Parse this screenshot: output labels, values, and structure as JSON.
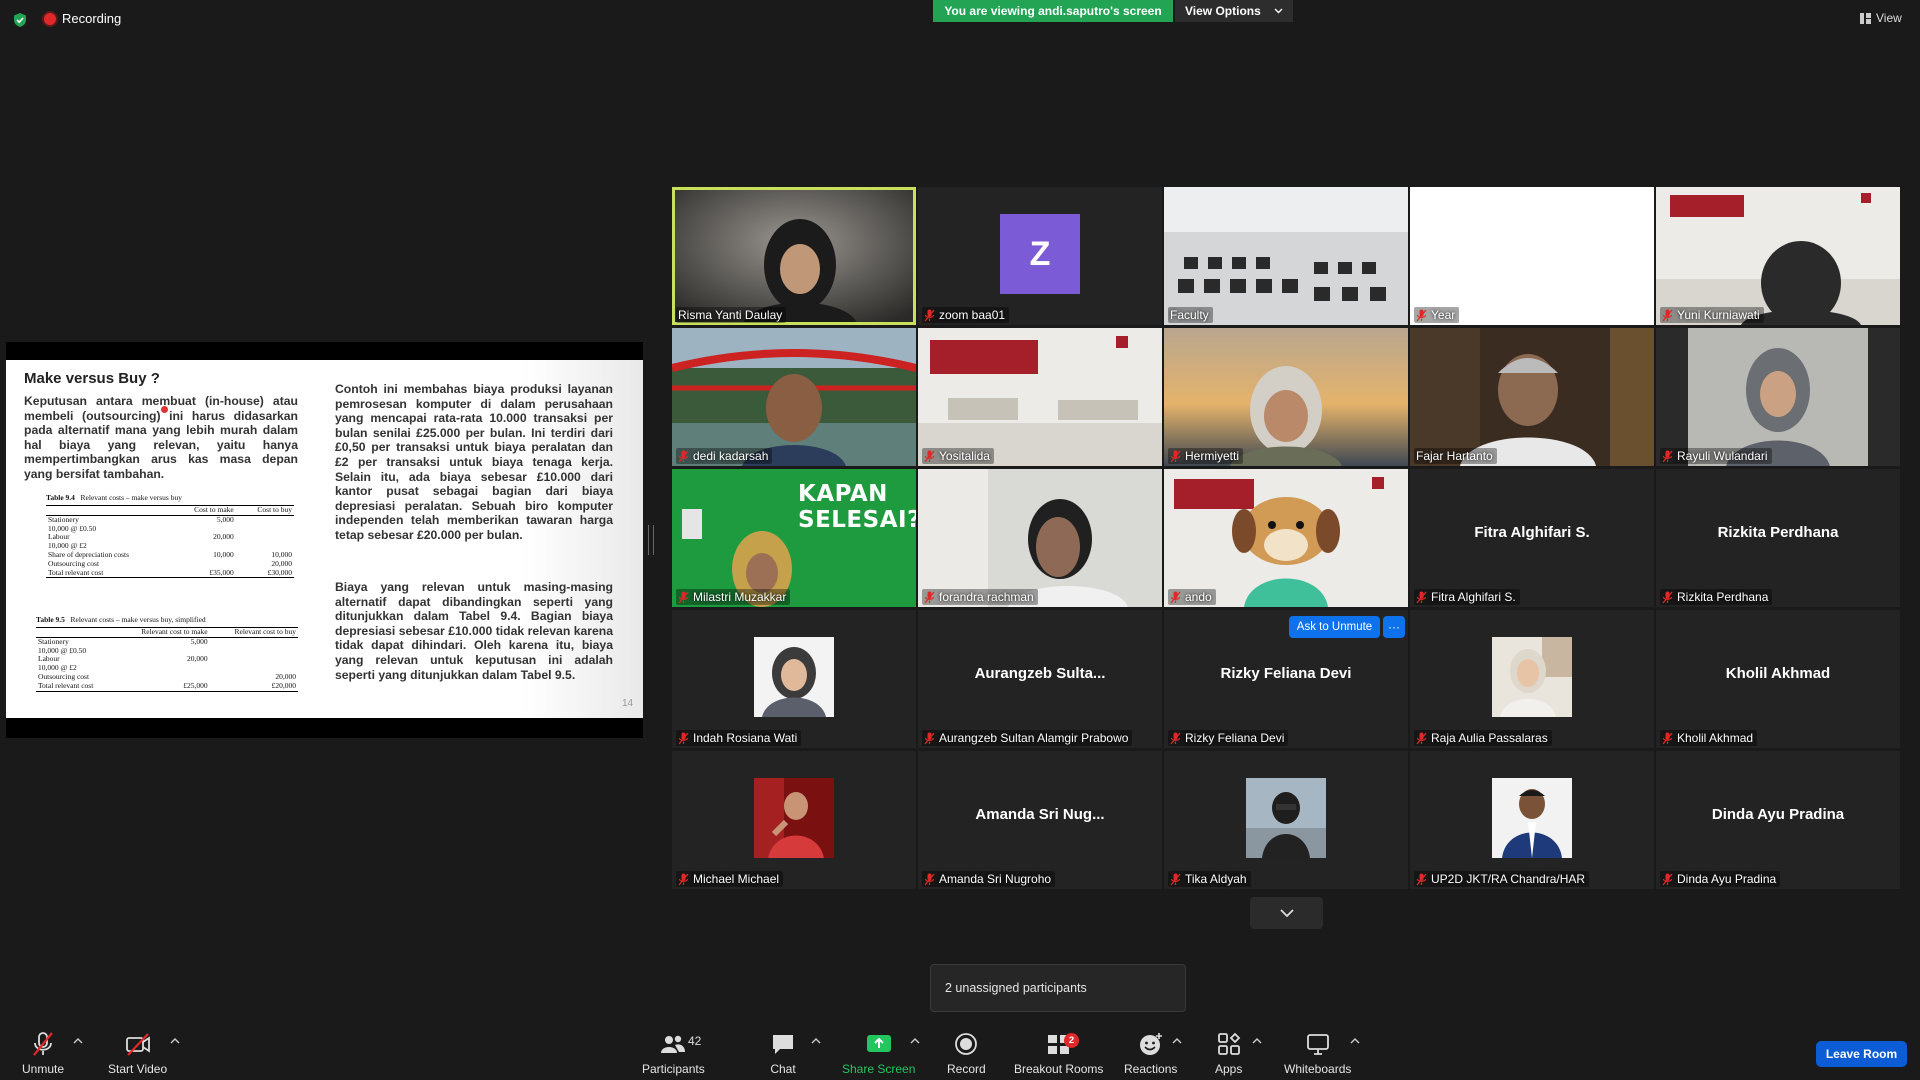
{
  "top": {
    "recording": "Recording",
    "viewing_banner": "You are viewing andi.saputro's screen",
    "view_options": "View Options",
    "view": "View"
  },
  "slide": {
    "title": "Make versus Buy ?",
    "para1": "Keputusan antara membuat (in-house) atau membeli (outsourcing) ini harus didasarkan pada alternatif mana yang lebih murah dalam hal biaya yang relevan, yaitu hanya mempertimbangkan arus kas masa depan yang bersifat tambahan.",
    "para2": "Contoh ini membahas biaya produksi layanan pemrosesan komputer di dalam perusahaan yang mencapai rata-rata 10.000 transaksi per bulan senilai £25.000 per bulan. Ini terdiri dari £0,50 per transaksi untuk biaya peralatan dan £2 per transaksi untuk biaya tenaga kerja. Selain itu, ada biaya sebesar £10.000 dari kantor pusat sebagai bagian dari biaya depresiasi peralatan. Sebuah biro komputer independen telah memberikan tawaran harga tetap sebesar £20.000 per bulan.",
    "para3": "Biaya yang relevan untuk masing-masing alternatif dapat dibandingkan seperti yang ditunjukkan dalam Tabel 9.4. Bagian biaya depresiasi sebesar £10.000 tidak relevan karena tidak dapat dihindari. Oleh karena itu, biaya yang relevan untuk keputusan ini adalah seperti yang ditunjukkan dalam Tabel 9.5.",
    "page_number": "14",
    "table94": {
      "caption_id": "Table 9.4",
      "caption": "Relevant costs – make versus buy",
      "headers": [
        "",
        "Cost to make",
        "Cost to buy"
      ],
      "rows": [
        [
          "Stationery",
          "5,000",
          ""
        ],
        [
          "10,000 @ £0.50",
          "",
          ""
        ],
        [
          "Labour",
          "20,000",
          ""
        ],
        [
          "10,000 @ £2",
          "",
          ""
        ],
        [
          "Share of depreciation costs",
          "10,000",
          "10,000"
        ],
        [
          "Outsourcing cost",
          "",
          "20,000"
        ],
        [
          "Total relevant cost",
          "£35,000",
          "£30,000"
        ]
      ]
    },
    "table95": {
      "caption_id": "Table 9.5",
      "caption": "Relevant costs – make versus buy, simplified",
      "headers": [
        "",
        "Relevant cost to make",
        "Relevant cost to buy"
      ],
      "rows": [
        [
          "Stationery",
          "5,000",
          ""
        ],
        [
          "10,000 @ £0.50",
          "",
          ""
        ],
        [
          "Labour",
          "20,000",
          ""
        ],
        [
          "10,000 @ £2",
          "",
          ""
        ],
        [
          "Outsourcing cost",
          "",
          "20,000"
        ],
        [
          "Total relevant cost",
          "£25,000",
          "£20,000"
        ]
      ]
    }
  },
  "participants": [
    {
      "name": "Risma Yanti Daulay",
      "video": "webcam-woman-hijab",
      "active": true,
      "muted": false
    },
    {
      "name": "zoom baa01",
      "avatar_letter": "Z",
      "muted": true
    },
    {
      "name": "Faculty",
      "video": "classroom",
      "muted": false
    },
    {
      "name": "Year",
      "video": "blank",
      "muted": true
    },
    {
      "name": "Yuni Kurniawati",
      "video": "virtual-background-office",
      "muted": true
    },
    {
      "name": "dedi kadarsah",
      "video": "bridge-background",
      "muted": true
    },
    {
      "name": "Yositalida",
      "video": "virtual-background-office",
      "muted": true
    },
    {
      "name": "Hermiyetti",
      "video": "sunset-background",
      "muted": true
    },
    {
      "name": "Fajar Hartanto",
      "video": "forest-background",
      "muted": false
    },
    {
      "name": "Rayuli Wulandari",
      "video": "rain-background",
      "muted": true
    },
    {
      "name": "Milastri Muzakkar",
      "video": "kapan-selesai-poster",
      "poster_text": "KAPAN SELESAI?",
      "muted": true
    },
    {
      "name": "forandra rachman",
      "video": "webcam-man",
      "muted": true
    },
    {
      "name": "ando",
      "video": "dog-mascot",
      "muted": true
    },
    {
      "name": "Fitra Alghifari S.",
      "display_name": "Fitra Alghifari S.",
      "muted": true
    },
    {
      "name": "Rizkita Perdhana",
      "display_name": "Rizkita Perdhana",
      "muted": true
    },
    {
      "name": "Indah Rosiana Wati",
      "avatar": "photo-woman-hijab",
      "muted": true
    },
    {
      "name": "Aurangzeb Sultan Alamgir Prabowo",
      "display_name": "Aurangzeb Sulta...",
      "muted": true
    },
    {
      "name": "Rizky Feliana Devi",
      "display_name": "Rizky Feliana Devi",
      "muted": true,
      "ask_to_unmute": "Ask to Unmute",
      "more": "···"
    },
    {
      "name": "Raja Aulia Passalaras",
      "avatar": "photo-woman-hijab-light",
      "muted": true
    },
    {
      "name": "Kholil Akhmad",
      "display_name": "Kholil Akhmad",
      "muted": true
    },
    {
      "name": "Michael Michael",
      "avatar": "photo-man-red",
      "muted": true
    },
    {
      "name": "Amanda Sri Nugroho",
      "display_name": "Amanda Sri Nug...",
      "muted": true
    },
    {
      "name": "Tika Aldyah",
      "avatar": "photo-person-beach",
      "muted": true
    },
    {
      "name": "UP2D JKT/RA Chandra/HAR",
      "avatar": "photo-man-uniform",
      "muted": true
    },
    {
      "name": "Dinda Ayu Pradina",
      "display_name": "Dinda Ayu Pradina",
      "muted": true
    }
  ],
  "toast": "2 unassigned participants",
  "toolbar": {
    "unmute": "Unmute",
    "start_video": "Start Video",
    "participants": "Participants",
    "participants_count": "42",
    "chat": "Chat",
    "share_screen": "Share Screen",
    "record": "Record",
    "breakout_rooms": "Breakout Rooms",
    "breakout_badge": "2",
    "reactions": "Reactions",
    "apps": "Apps",
    "whiteboards": "Whiteboards",
    "leave_room": "Leave Room"
  },
  "colors": {
    "background": "#1a1a1a",
    "tile": "#232323",
    "viewing_banner": "#23a455",
    "active_speaker": "#c8e05a",
    "accent_blue": "#0e72ed",
    "muted_red": "#e02828",
    "share_green": "#22c55e"
  }
}
